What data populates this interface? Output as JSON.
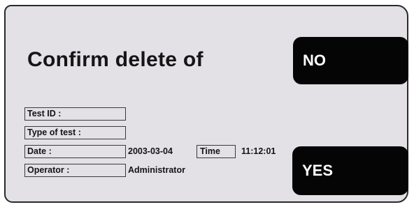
{
  "dialog": {
    "title": "Confirm delete of",
    "no_label": "NO",
    "yes_label": "YES"
  },
  "fields": {
    "test_id": {
      "label": "Test ID :",
      "value": ""
    },
    "type_of_test": {
      "label": "Type of test :",
      "value": ""
    },
    "date": {
      "label": "Date :",
      "value": "2003-03-04"
    },
    "time": {
      "label": "Time",
      "value": "11:12:01"
    },
    "operator": {
      "label": "Operator :",
      "value": "Administrator"
    }
  },
  "colors": {
    "dialog_background": "#e3e0e6",
    "button_background": "#050505",
    "button_text": "#ffffff"
  }
}
